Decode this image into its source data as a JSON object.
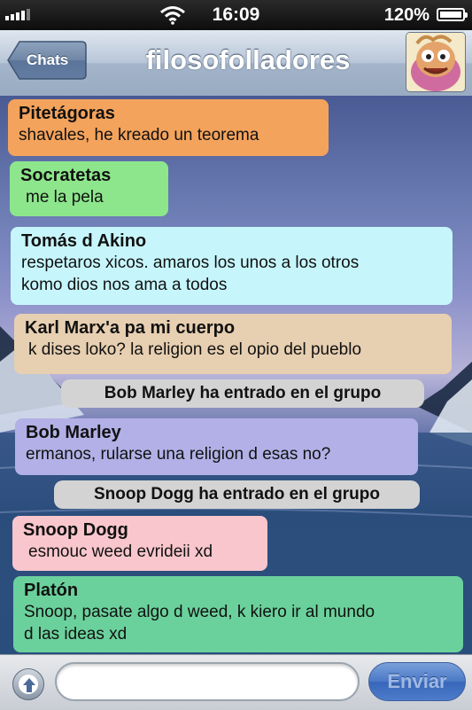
{
  "status_bar": {
    "time": "16:09",
    "battery": "120%"
  },
  "nav": {
    "back_label": "Chats",
    "title": "filosofolladores"
  },
  "messages": [
    {
      "sender": "Pitetágoras",
      "text": "shavales, he kreado un teorema",
      "color": "#f4a35c"
    },
    {
      "sender": "Socratetas",
      "text": "me la pela",
      "color": "#8de68c"
    },
    {
      "sender": "Tomás d Akino",
      "text_lines": [
        "respetaros xicos. amaros los unos a los otros",
        "komo dios nos ama a todos"
      ],
      "color": "#c6f6fb"
    },
    {
      "sender": "Karl Marx'a pa mi cuerpo",
      "text": "k dises loko? la religion es el opio del pueblo",
      "color": "#e7cfb1"
    },
    {
      "system": "Bob Marley ha entrado en el grupo"
    },
    {
      "sender": "Bob Marley",
      "text": "ermanos, rularse una religion d esas no?",
      "color": "#b2b0e6"
    },
    {
      "system": "Snoop Dogg ha entrado en el grupo"
    },
    {
      "sender": "Snoop Dogg",
      "text": "esmouc weed evrideii xd",
      "color": "#f8c6cc"
    },
    {
      "sender": "Platón",
      "text_lines": [
        "Snoop, pasate algo d weed, k kiero ir al mundo",
        "d las ideas xd"
      ],
      "color": "#6bd19c"
    }
  ],
  "input": {
    "value": "",
    "placeholder": ""
  },
  "send_label": "Enviar",
  "icons": {
    "back": "chevron-left-icon",
    "upload": "arrow-up-icon",
    "wifi": "wifi-icon",
    "battery": "battery-icon",
    "signal": "signal-icon"
  }
}
